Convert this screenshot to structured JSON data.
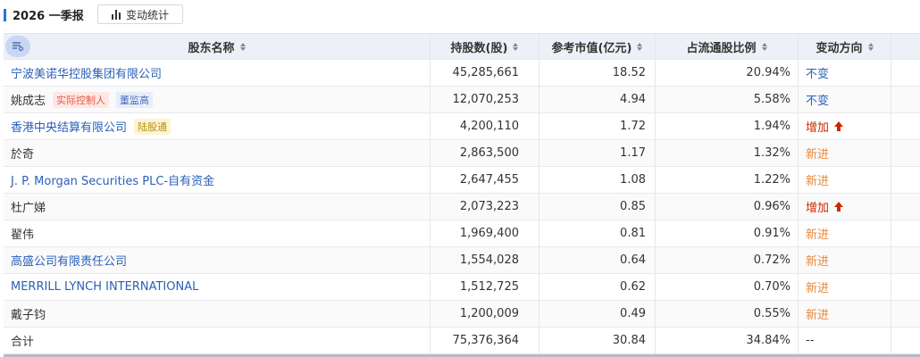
{
  "header": {
    "period": "2026 一季报",
    "stat_button": "变动统计",
    "stat_icon": "bar-chart-icon"
  },
  "table": {
    "filter_icon": "filter-list-icon",
    "columns": [
      "股东名称",
      "持股数(股)",
      "参考市值(亿元)",
      "占流通股比例",
      "变动方向"
    ],
    "rows": [
      {
        "name": "宁波美诺华控股集团有限公司",
        "link": true,
        "tags": [],
        "shares": "45,285,661",
        "value": "18.52",
        "ratio": "20.94%",
        "direction": "不变",
        "dir_type": "same"
      },
      {
        "name": "姚成志",
        "link": false,
        "tags": [
          {
            "text": "实际控制人",
            "style": "red"
          },
          {
            "text": "董监高",
            "style": "blue"
          }
        ],
        "shares": "12,070,253",
        "value": "4.94",
        "ratio": "5.58%",
        "direction": "不变",
        "dir_type": "same"
      },
      {
        "name": "香港中央结算有限公司",
        "link": true,
        "tags": [
          {
            "text": "陆股通",
            "style": "yellow"
          }
        ],
        "shares": "4,200,110",
        "value": "1.72",
        "ratio": "1.94%",
        "direction": "增加",
        "dir_type": "up"
      },
      {
        "name": "於奇",
        "link": false,
        "tags": [],
        "shares": "2,863,500",
        "value": "1.17",
        "ratio": "1.32%",
        "direction": "新进",
        "dir_type": "new"
      },
      {
        "name": "J. P. Morgan Securities PLC-自有资金",
        "link": true,
        "tags": [],
        "shares": "2,647,455",
        "value": "1.08",
        "ratio": "1.22%",
        "direction": "新进",
        "dir_type": "new"
      },
      {
        "name": "杜广娣",
        "link": false,
        "tags": [],
        "shares": "2,073,223",
        "value": "0.85",
        "ratio": "0.96%",
        "direction": "增加",
        "dir_type": "up"
      },
      {
        "name": "翟伟",
        "link": false,
        "tags": [],
        "shares": "1,969,400",
        "value": "0.81",
        "ratio": "0.91%",
        "direction": "新进",
        "dir_type": "new"
      },
      {
        "name": "高盛公司有限责任公司",
        "link": true,
        "tags": [],
        "shares": "1,554,028",
        "value": "0.64",
        "ratio": "0.72%",
        "direction": "新进",
        "dir_type": "new"
      },
      {
        "name": "MERRILL LYNCH INTERNATIONAL",
        "link": true,
        "tags": [],
        "shares": "1,512,725",
        "value": "0.62",
        "ratio": "0.70%",
        "direction": "新进",
        "dir_type": "new"
      },
      {
        "name": "戴子钧",
        "link": false,
        "tags": [],
        "shares": "1,200,009",
        "value": "0.49",
        "ratio": "0.55%",
        "direction": "新进",
        "dir_type": "new"
      }
    ],
    "total": {
      "name": "合计",
      "shares": "75,376,364",
      "value": "30.84",
      "ratio": "34.84%",
      "direction": "--"
    }
  },
  "colors": {
    "accent": "#2f6fe0",
    "link": "#2a5fb8",
    "increase": "#cc2a00",
    "new": "#e8883a"
  }
}
